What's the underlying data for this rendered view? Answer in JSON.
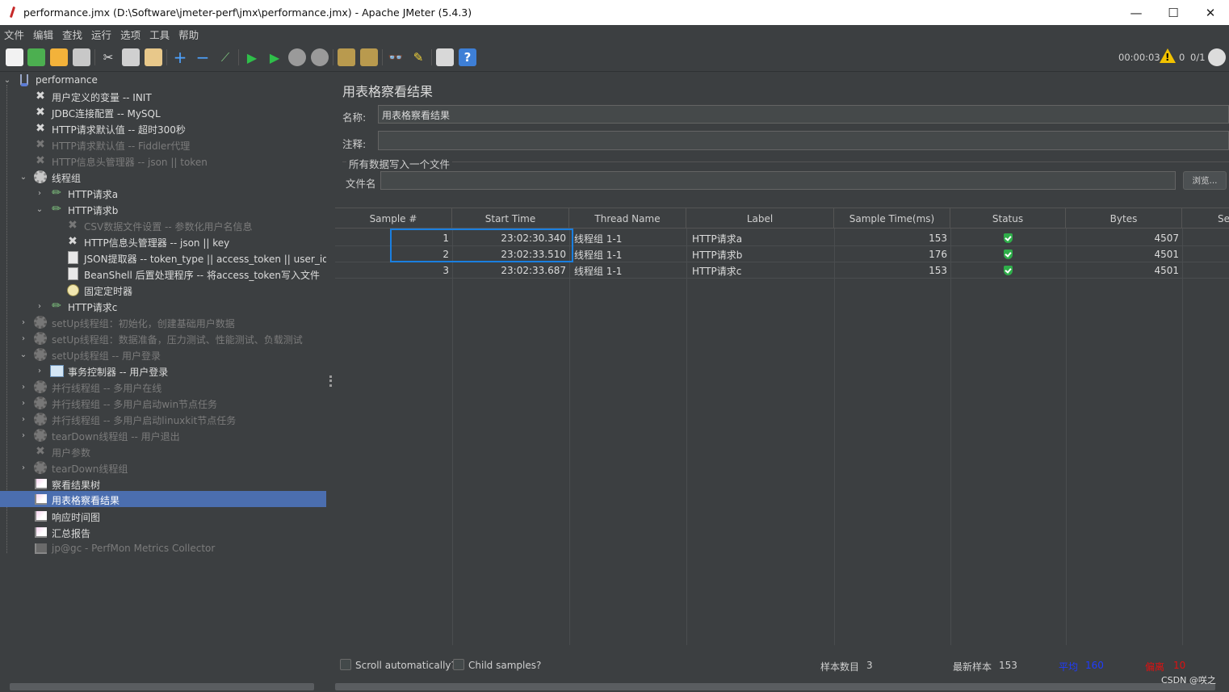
{
  "window": {
    "title": "performance.jmx (D:\\Software\\jmeter-perf\\jmx\\performance.jmx) - Apache JMeter (5.4.3)",
    "minimize": "—",
    "maximize": "☐",
    "close": "✕"
  },
  "menu": [
    "文件",
    "编辑",
    "查找",
    "运行",
    "选项",
    "工具",
    "帮助"
  ],
  "toolbar": {
    "elapsed": "00:00:03",
    "warning_mark": "!",
    "error_count": "0",
    "threads": "0/1"
  },
  "tree": [
    {
      "label": "performance",
      "icon": "flask-icon",
      "disabled": false
    },
    {
      "label": "用户定义的变量 -- INIT",
      "icon": "wrench-icon",
      "disabled": false
    },
    {
      "label": "JDBC连接配置 -- MySQL",
      "icon": "wrench-icon",
      "disabled": false
    },
    {
      "label": "HTTP请求默认值 -- 超时300秒",
      "icon": "wrench-icon",
      "disabled": false
    },
    {
      "label": "HTTP请求默认值 -- Fiddler代理",
      "icon": "wrench-icon",
      "disabled": true
    },
    {
      "label": "HTTP信息头管理器 -- json || token",
      "icon": "wrench-icon",
      "disabled": true
    },
    {
      "label": "线程组",
      "icon": "gear-icon",
      "disabled": false
    },
    {
      "label": "HTTP请求a",
      "icon": "pencil-icon",
      "disabled": false
    },
    {
      "label": "HTTP请求b",
      "icon": "pencil-icon",
      "disabled": false
    },
    {
      "label": "CSV数据文件设置 -- 参数化用户名信息",
      "icon": "wrench-icon",
      "disabled": true
    },
    {
      "label": "HTTP信息头管理器 --  json || key",
      "icon": "wrench-icon",
      "disabled": false
    },
    {
      "label": "JSON提取器 -- token_type || access_token || user_id || stat",
      "icon": "document-icon",
      "disabled": false
    },
    {
      "label": "BeanShell 后置处理程序 -- 将access_token写入文件",
      "icon": "document-icon",
      "disabled": false
    },
    {
      "label": "固定定时器",
      "icon": "clock-icon",
      "disabled": false
    },
    {
      "label": "HTTP请求c",
      "icon": "pencil-icon",
      "disabled": false
    },
    {
      "label": "setUp线程组：初始化，创建基础用户数据",
      "icon": "gear-icon",
      "disabled": true
    },
    {
      "label": "setUp线程组：数据准备，压力测试、性能测试、负载测试",
      "icon": "gear-icon",
      "disabled": true
    },
    {
      "label": "setUp线程组 -- 用户登录",
      "icon": "gear-icon",
      "disabled": true
    },
    {
      "label": "事务控制器 -- 用户登录",
      "icon": "controller-icon",
      "disabled": false
    },
    {
      "label": "并行线程组 -- 多用户在线",
      "icon": "gear-icon",
      "disabled": true
    },
    {
      "label": "并行线程组 -- 多用户启动win节点任务",
      "icon": "gear-icon",
      "disabled": true
    },
    {
      "label": "并行线程组 -- 多用户启动linuxkit节点任务",
      "icon": "gear-icon",
      "disabled": true
    },
    {
      "label": "tearDown线程组 -- 用户退出",
      "icon": "gear-icon",
      "disabled": true
    },
    {
      "label": "用户参数",
      "icon": "wrench-icon",
      "disabled": true
    },
    {
      "label": "tearDown线程组",
      "icon": "gear-icon",
      "disabled": true
    },
    {
      "label": "察看结果树",
      "icon": "chart-icon",
      "disabled": false
    },
    {
      "label": "用表格察看结果",
      "icon": "chart-icon",
      "disabled": false,
      "selected": true
    },
    {
      "label": "响应时间图",
      "icon": "chart-icon",
      "disabled": false
    },
    {
      "label": "汇总报告",
      "icon": "chart-icon",
      "disabled": false
    },
    {
      "label": "jp@gc - PerfMon Metrics Collector",
      "icon": "chart-icon",
      "disabled": true
    }
  ],
  "panel": {
    "title": "用表格察看结果",
    "name_label": "名称:",
    "name_value": "用表格察看结果",
    "comment_label": "注释:",
    "comment_value": "",
    "group_title": "所有数据写入一个文件",
    "file_label": "文件名",
    "file_value": "",
    "browse_label": "浏览..."
  },
  "table": {
    "columns": [
      "Sample #",
      "Start Time",
      "Thread Name",
      "Label",
      "Sample Time(ms)",
      "Status",
      "Bytes",
      "Se"
    ],
    "rows": [
      {
        "sample": "1",
        "start": "23:02:30.340",
        "thread": "线程组 1-1",
        "label": "HTTP请求a",
        "time": "153",
        "status": "success",
        "bytes": "4507"
      },
      {
        "sample": "2",
        "start": "23:02:33.510",
        "thread": "线程组 1-1",
        "label": "HTTP请求b",
        "time": "176",
        "status": "success",
        "bytes": "4501"
      },
      {
        "sample": "3",
        "start": "23:02:33.687",
        "thread": "线程组 1-1",
        "label": "HTTP请求c",
        "time": "153",
        "status": "success",
        "bytes": "4501"
      }
    ]
  },
  "footer": {
    "scroll_label": "Scroll automatically?",
    "child_label": "Child samples?",
    "count_label": "样本数目",
    "count_value": "3",
    "latest_label": "最新样本",
    "latest_value": "153",
    "avg_label": "平均",
    "avg_value": "160",
    "dev_label": "偏离",
    "dev_value": "10",
    "avg_color": "#1f3cff",
    "dev_color": "#e01010"
  },
  "watermark": "CSDN @咲之"
}
